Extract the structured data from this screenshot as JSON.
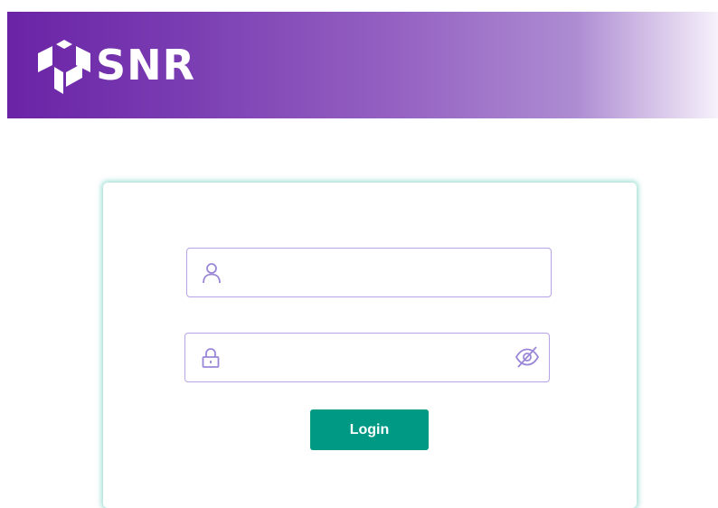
{
  "header": {
    "brand_name": "SNR",
    "icon": "cube-logo-icon",
    "gradient_colors": [
      "#6a23a6",
      "#9562c2",
      "#f6f1fb"
    ]
  },
  "login_form": {
    "username": {
      "icon": "user-icon",
      "value": "",
      "placeholder": ""
    },
    "password": {
      "icon": "lock-icon",
      "toggle_icon": "eye-slash-icon",
      "value": "",
      "placeholder": ""
    },
    "login_label": "Login"
  },
  "colors": {
    "field_border": "#b7a4e6",
    "icon_color": "#9b87d8",
    "button": "#009984",
    "card_glow": "#52c4b0"
  }
}
